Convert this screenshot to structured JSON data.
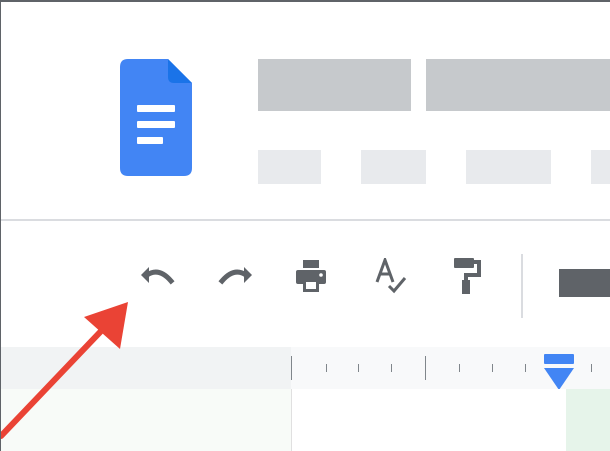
{
  "app": {
    "name": "Google Docs"
  },
  "toolbar": {
    "tools": [
      {
        "name": "undo-icon"
      },
      {
        "name": "redo-icon"
      },
      {
        "name": "print-icon"
      },
      {
        "name": "spellcheck-icon"
      },
      {
        "name": "paint-format-icon"
      }
    ]
  },
  "annotation": {
    "type": "arrow",
    "target": "undo-button",
    "color": "#ea4335"
  },
  "colors": {
    "docs_blue": "#4285f4",
    "icon_gray": "#5f6368",
    "placeholder": "#c6c9cc",
    "ruler_marker": "#4285f4",
    "arrow": "#ea4335"
  }
}
